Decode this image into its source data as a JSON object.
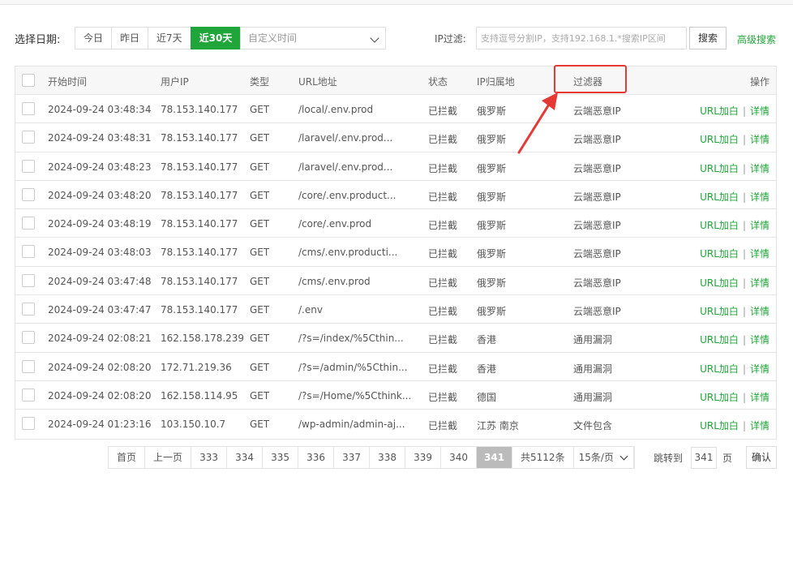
{
  "filter": {
    "date_label": "选择日期:",
    "date_buttons": [
      "今日",
      "昨日",
      "近7天",
      "近30天"
    ],
    "active_date": "近30天",
    "custom_time_placeholder": "自定义时间",
    "ip_label": "IP过滤:",
    "ip_placeholder": "支持逗号分割IP，支持192.168.1.*搜索IP区间",
    "search_label": "搜索",
    "advanced_search_label": "高级搜索"
  },
  "table": {
    "headers": {
      "start_time": "开始时间",
      "user_ip": "用户IP",
      "type": "类型",
      "url": "URL地址",
      "status": "状态",
      "ip_region": "IP归属地",
      "filter": "过滤器",
      "actions": "操作"
    },
    "rows": [
      {
        "time": "2024-09-24 03:48:34",
        "ip": "78.153.140.177",
        "type": "GET",
        "url": "/local/.env.prod",
        "status": "已拦截",
        "region": "俄罗斯",
        "filter": "云端恶意IP"
      },
      {
        "time": "2024-09-24 03:48:31",
        "ip": "78.153.140.177",
        "type": "GET",
        "url": "/laravel/.env.prod...",
        "status": "已拦截",
        "region": "俄罗斯",
        "filter": "云端恶意IP"
      },
      {
        "time": "2024-09-24 03:48:23",
        "ip": "78.153.140.177",
        "type": "GET",
        "url": "/laravel/.env.prod...",
        "status": "已拦截",
        "region": "俄罗斯",
        "filter": "云端恶意IP"
      },
      {
        "time": "2024-09-24 03:48:20",
        "ip": "78.153.140.177",
        "type": "GET",
        "url": "/core/.env.product...",
        "status": "已拦截",
        "region": "俄罗斯",
        "filter": "云端恶意IP"
      },
      {
        "time": "2024-09-24 03:48:19",
        "ip": "78.153.140.177",
        "type": "GET",
        "url": "/core/.env.prod",
        "status": "已拦截",
        "region": "俄罗斯",
        "filter": "云端恶意IP"
      },
      {
        "time": "2024-09-24 03:48:03",
        "ip": "78.153.140.177",
        "type": "GET",
        "url": "/cms/.env.producti...",
        "status": "已拦截",
        "region": "俄罗斯",
        "filter": "云端恶意IP"
      },
      {
        "time": "2024-09-24 03:47:48",
        "ip": "78.153.140.177",
        "type": "GET",
        "url": "/cms/.env.prod",
        "status": "已拦截",
        "region": "俄罗斯",
        "filter": "云端恶意IP"
      },
      {
        "time": "2024-09-24 03:47:47",
        "ip": "78.153.140.177",
        "type": "GET",
        "url": "/.env",
        "status": "已拦截",
        "region": "俄罗斯",
        "filter": "云端恶意IP"
      },
      {
        "time": "2024-09-24 02:08:21",
        "ip": "162.158.178.239",
        "type": "GET",
        "url": "/?s=/index/%5Cthin...",
        "status": "已拦截",
        "region": "香港",
        "filter": "通用漏洞"
      },
      {
        "time": "2024-09-24 02:08:20",
        "ip": "172.71.219.36",
        "type": "GET",
        "url": "/?s=/admin/%5Cthin...",
        "status": "已拦截",
        "region": "香港",
        "filter": "通用漏洞"
      },
      {
        "time": "2024-09-24 02:08:20",
        "ip": "162.158.114.95",
        "type": "GET",
        "url": "/?s=/Home/%5Cthink...",
        "status": "已拦截",
        "region": "德国",
        "filter": "通用漏洞"
      },
      {
        "time": "2024-09-24 01:23:16",
        "ip": "103.150.10.7",
        "type": "GET",
        "url": "/wp-admin/admin-aj...",
        "status": "已拦截",
        "region": "江苏 南京",
        "filter": "文件包含"
      }
    ],
    "action_whitelist": "URL加白",
    "action_sep": "|",
    "action_detail": "详情"
  },
  "pagination": {
    "first": "首页",
    "prev": "上一页",
    "pages": [
      "333",
      "334",
      "335",
      "336",
      "337",
      "338",
      "339",
      "340",
      "341"
    ],
    "current": "341",
    "total": "共5112条",
    "per_page": "15条/页",
    "jump_label": "跳转到",
    "jump_value": "341",
    "page_unit": "页",
    "confirm": "确认"
  },
  "colors": {
    "accent": "#20a53a",
    "highlight_red": "#e53935",
    "current_page": "#bbbbbb"
  }
}
